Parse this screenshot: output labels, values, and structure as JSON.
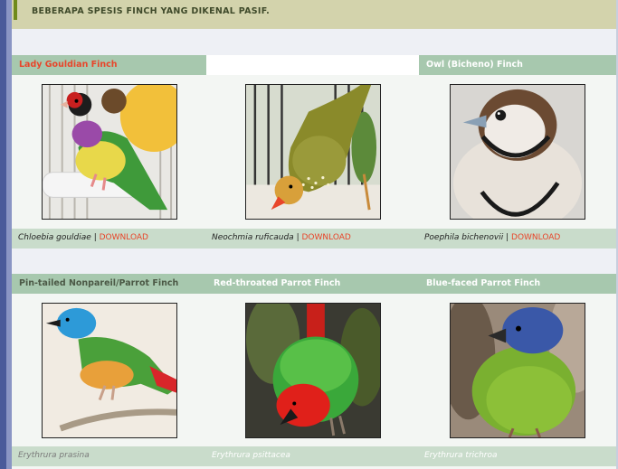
{
  "header": {
    "title": "BEBERAPA SPESIS FINCH YANG DIKENAL PASIF."
  },
  "section1": {
    "cards": [
      {
        "name": "Lady Gouldian Finch",
        "scientific": "Chloebia gouldiae",
        "separator": "|",
        "download": "DOWNLOAD"
      },
      {
        "name": "",
        "scientific": "Neochmia ruficauda",
        "separator": "|",
        "download": "DOWNLOAD"
      },
      {
        "name": "Owl (Bicheno) Finch",
        "scientific": "Poephila bichenovii",
        "separator": "|",
        "download": "DOWNLOAD"
      }
    ]
  },
  "section2": {
    "cards": [
      {
        "name": "Pin-tailed Nonpareil/Parrot Finch",
        "scientific": "Erythrura prasina"
      },
      {
        "name": "Red-throated Parrot Finch",
        "scientific": "Erythrura psittacea"
      },
      {
        "name": "Blue-faced Parrot Finch",
        "scientific": "Erythrura trichroa"
      }
    ]
  },
  "colors": {
    "header_bg": "#d3d3ac",
    "header_accent": "#6f8a1a",
    "row_header_bg": "#a7c8ae",
    "caption_bg": "#c9dccb",
    "download_link": "#e8452a",
    "left_bar": "#4a5a9a"
  }
}
